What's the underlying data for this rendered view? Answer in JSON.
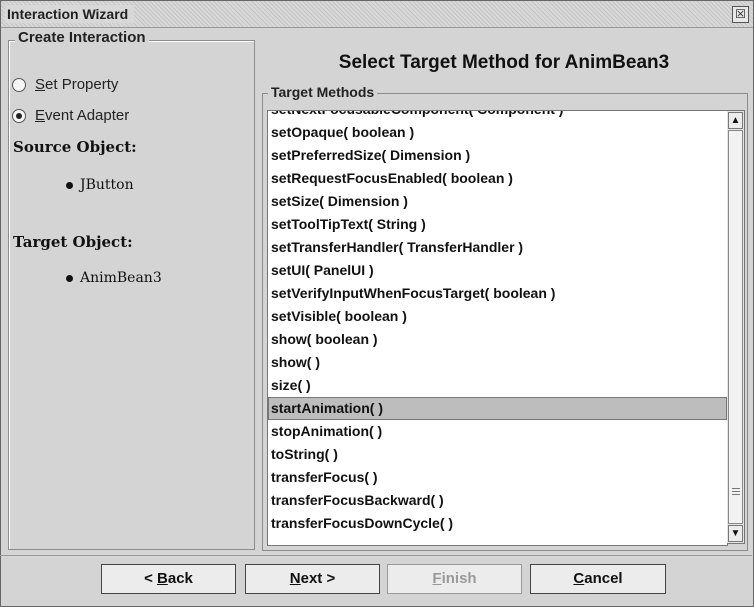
{
  "window": {
    "title": "Interaction Wizard",
    "close_glyph": "☒"
  },
  "left": {
    "group_title": "Create Interaction",
    "radio_set_property": {
      "mnemonic": "S",
      "rest": "et Property",
      "selected": false
    },
    "radio_event_adapter": {
      "mnemonic": "E",
      "rest": "vent Adapter",
      "selected": true
    },
    "source_heading": "Source Object:",
    "source_value": "JButton",
    "target_heading": "Target Object:",
    "target_value": "AnimBean3"
  },
  "header": {
    "title": "Select Target Method for AnimBean3"
  },
  "methods_group": {
    "title": "Target Methods",
    "items": [
      "setNextFocusableComponent( Component )",
      "setOpaque( boolean )",
      "setPreferredSize( Dimension )",
      "setRequestFocusEnabled( boolean )",
      "setSize( Dimension )",
      "setToolTipText( String )",
      "setTransferHandler( TransferHandler )",
      "setUI( PanelUI )",
      "setVerifyInputWhenFocusTarget( boolean )",
      "setVisible( boolean )",
      "show( boolean )",
      "show( )",
      "size( )",
      "startAnimation( )",
      "stopAnimation( )",
      "toString( )",
      "transferFocus( )",
      "transferFocusBackward( )",
      "transferFocusDownCycle( )"
    ],
    "selected_index": 13
  },
  "scrollbar": {
    "up_glyph": "▲",
    "down_glyph": "▼"
  },
  "buttons": {
    "back": {
      "pre": "< ",
      "mnemonic": "B",
      "post": "ack"
    },
    "next": {
      "pre": "",
      "mnemonic": "N",
      "post": "ext >"
    },
    "finish": {
      "pre": "",
      "mnemonic": "F",
      "post": "inish"
    },
    "cancel": {
      "pre": "",
      "mnemonic": "C",
      "post": "ancel"
    }
  }
}
